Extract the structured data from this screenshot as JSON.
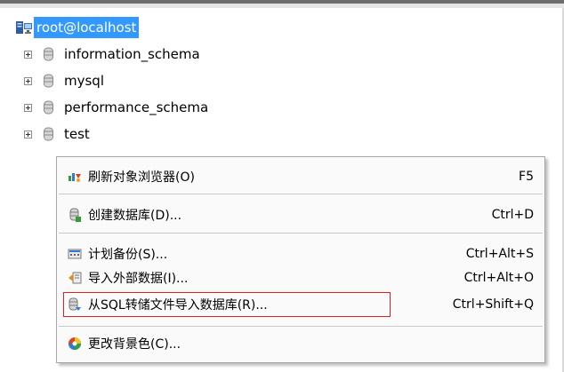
{
  "tree": {
    "root": {
      "label": "root@localhost",
      "icon": "server-computer-icon"
    },
    "nodes": [
      {
        "label": "information_schema",
        "icon": "database-icon"
      },
      {
        "label": "mysql",
        "icon": "database-icon"
      },
      {
        "label": "performance_schema",
        "icon": "database-icon"
      },
      {
        "label": "test",
        "icon": "database-icon"
      }
    ]
  },
  "context_menu": {
    "items": [
      {
        "label": "刷新对象浏览器(O)",
        "shortcut": "F5",
        "icon": "refresh-icon"
      },
      {
        "label": "创建数据库(D)...",
        "shortcut": "Ctrl+D",
        "icon": "create-database-icon"
      },
      {
        "label": "计划备份(S)...",
        "shortcut": "Ctrl+Alt+S",
        "icon": "scheduled-backup-icon"
      },
      {
        "label": "导入外部数据(I)...",
        "shortcut": "Ctrl+Alt+O",
        "icon": "import-external-data-icon"
      },
      {
        "label": "从SQL转储文件导入数据库(R)...",
        "shortcut": "Ctrl+Shift+Q",
        "icon": "import-sql-dump-icon"
      },
      {
        "label": "更改背景色(C)...",
        "shortcut": "",
        "icon": "color-wheel-icon"
      }
    ],
    "highlight_color": "#e02020"
  },
  "colors": {
    "selection": "#3399ff",
    "menu_bg": "#fafafa"
  }
}
